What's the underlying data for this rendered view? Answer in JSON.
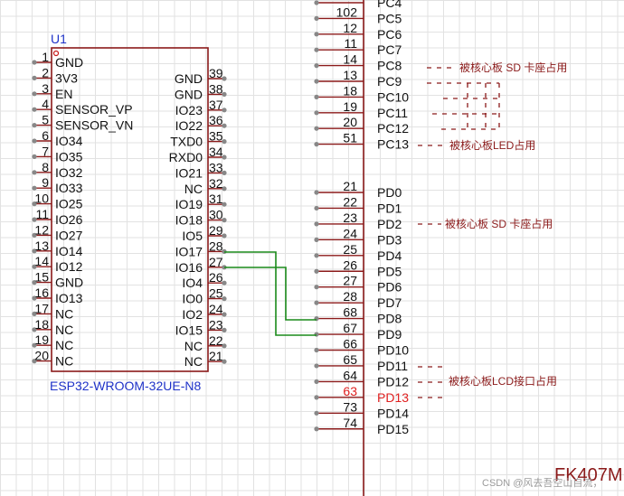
{
  "u1": {
    "designator": "U1",
    "part": "ESP32-WROOM-32UE-N8",
    "left_pins": [
      {
        "num": "1",
        "name": "GND"
      },
      {
        "num": "2",
        "name": "3V3"
      },
      {
        "num": "3",
        "name": "EN"
      },
      {
        "num": "4",
        "name": "SENSOR_VP"
      },
      {
        "num": "5",
        "name": "SENSOR_VN"
      },
      {
        "num": "6",
        "name": "IO34"
      },
      {
        "num": "7",
        "name": "IO35"
      },
      {
        "num": "8",
        "name": "IO32"
      },
      {
        "num": "9",
        "name": "IO33"
      },
      {
        "num": "10",
        "name": "IO25"
      },
      {
        "num": "11",
        "name": "IO26"
      },
      {
        "num": "12",
        "name": "IO27"
      },
      {
        "num": "13",
        "name": "IO14"
      },
      {
        "num": "14",
        "name": "IO12"
      },
      {
        "num": "15",
        "name": "GND"
      },
      {
        "num": "16",
        "name": "IO13"
      },
      {
        "num": "17",
        "name": "NC"
      },
      {
        "num": "18",
        "name": "NC"
      },
      {
        "num": "19",
        "name": "NC"
      },
      {
        "num": "20",
        "name": "NC"
      }
    ],
    "right_pins": [
      {
        "num": "39",
        "name": "GND"
      },
      {
        "num": "38",
        "name": "GND"
      },
      {
        "num": "37",
        "name": "IO23"
      },
      {
        "num": "36",
        "name": "IO22"
      },
      {
        "num": "35",
        "name": "TXD0"
      },
      {
        "num": "34",
        "name": "RXD0"
      },
      {
        "num": "33",
        "name": "IO21"
      },
      {
        "num": "32",
        "name": "NC"
      },
      {
        "num": "31",
        "name": "IO19"
      },
      {
        "num": "30",
        "name": "IO18"
      },
      {
        "num": "29",
        "name": "IO5"
      },
      {
        "num": "28",
        "name": "IO17"
      },
      {
        "num": "27",
        "name": "IO16"
      },
      {
        "num": "26",
        "name": "IO4"
      },
      {
        "num": "25",
        "name": "IO0"
      },
      {
        "num": "24",
        "name": "IO2"
      },
      {
        "num": "23",
        "name": "IO15"
      },
      {
        "num": "22",
        "name": "NC"
      },
      {
        "num": "21",
        "name": "NC"
      }
    ]
  },
  "mcu": {
    "part_partial": "FK407M",
    "pins": [
      {
        "num": "",
        "name": "PC4",
        "highlight": false
      },
      {
        "num": "102",
        "name": "PC5",
        "highlight": false
      },
      {
        "num": "12",
        "name": "PC6",
        "highlight": false
      },
      {
        "num": "11",
        "name": "PC7",
        "highlight": false
      },
      {
        "num": "14",
        "name": "PC8",
        "highlight": false
      },
      {
        "num": "13",
        "name": "PC9",
        "highlight": false
      },
      {
        "num": "18",
        "name": "PC10",
        "highlight": false
      },
      {
        "num": "19",
        "name": "PC11",
        "highlight": false
      },
      {
        "num": "20",
        "name": "PC12",
        "highlight": false
      },
      {
        "num": "51",
        "name": "PC13",
        "highlight": false
      },
      {
        "num": "21",
        "name": "PD0",
        "highlight": false
      },
      {
        "num": "22",
        "name": "PD1",
        "highlight": false
      },
      {
        "num": "23",
        "name": "PD2",
        "highlight": false
      },
      {
        "num": "24",
        "name": "PD3",
        "highlight": false
      },
      {
        "num": "25",
        "name": "PD4",
        "highlight": false
      },
      {
        "num": "26",
        "name": "PD5",
        "highlight": false
      },
      {
        "num": "27",
        "name": "PD6",
        "highlight": false
      },
      {
        "num": "28",
        "name": "PD7",
        "highlight": false
      },
      {
        "num": "68",
        "name": "PD8",
        "highlight": false
      },
      {
        "num": "67",
        "name": "PD9",
        "highlight": false
      },
      {
        "num": "66",
        "name": "PD10",
        "highlight": false
      },
      {
        "num": "65",
        "name": "PD11",
        "highlight": false
      },
      {
        "num": "64",
        "name": "PD12",
        "highlight": false
      },
      {
        "num": "63",
        "name": "PD13",
        "highlight": true
      },
      {
        "num": "73",
        "name": "PD14",
        "highlight": false
      },
      {
        "num": "74",
        "name": "PD15",
        "highlight": false
      }
    ]
  },
  "notes": {
    "sd_pc": "被核心板 SD 卡座占用",
    "led": "被核心板LED占用",
    "sd_pd": "被核心板 SD 卡座占用",
    "lcd": "被核心板LCD接口占用"
  },
  "watermark": "CSDN @风去吾空山自流，",
  "colors": {
    "body": "#8b1a1a",
    "pin_text": "#111111",
    "part_name": "#1f33c8",
    "wire": "#1a8a1a",
    "highlight": "#e02020",
    "note": "#8b1a1a"
  }
}
